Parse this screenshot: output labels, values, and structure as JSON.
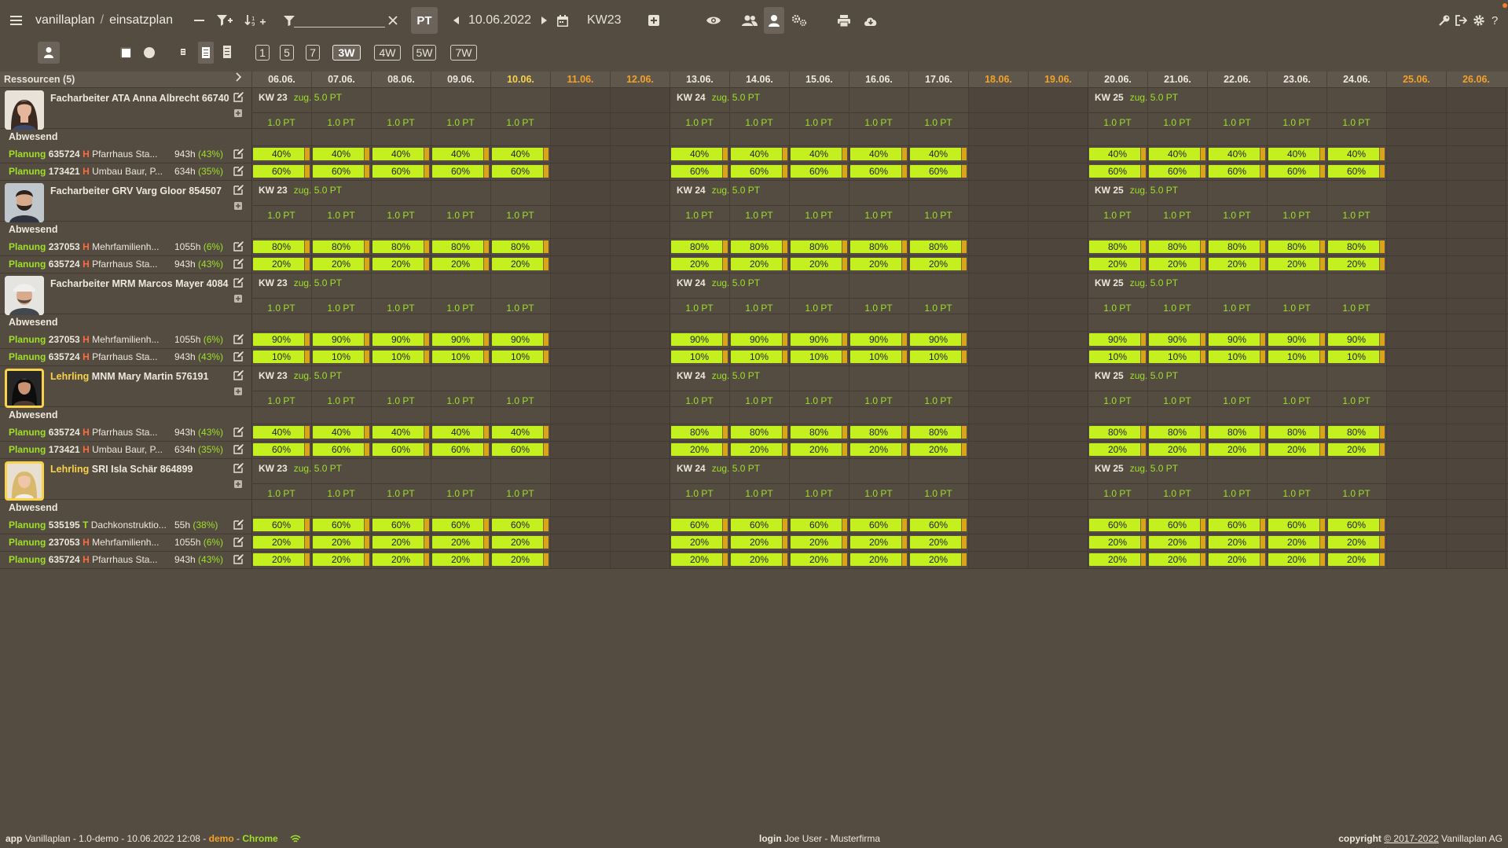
{
  "app": {
    "breadcrumb": [
      "vanillaplan",
      "einsatzplan"
    ],
    "pt_label": "PT",
    "date": "10.06.2022",
    "kw": "KW23",
    "filter_value": ""
  },
  "view_buttons": [
    "1",
    "5",
    "7",
    "3W",
    "4W",
    "5W",
    "7W"
  ],
  "selected_view": "3W",
  "resources_title": "Ressourcen (5)",
  "days": [
    {
      "label": "06.06.",
      "type": "normal"
    },
    {
      "label": "07.06.",
      "type": "normal"
    },
    {
      "label": "08.06.",
      "type": "normal"
    },
    {
      "label": "09.06.",
      "type": "normal"
    },
    {
      "label": "10.06.",
      "type": "current"
    },
    {
      "label": "11.06.",
      "type": "weekend"
    },
    {
      "label": "12.06.",
      "type": "weekend"
    },
    {
      "label": "13.06.",
      "type": "normal"
    },
    {
      "label": "14.06.",
      "type": "normal"
    },
    {
      "label": "15.06.",
      "type": "normal"
    },
    {
      "label": "16.06.",
      "type": "normal"
    },
    {
      "label": "17.06.",
      "type": "normal"
    },
    {
      "label": "18.06.",
      "type": "weekend"
    },
    {
      "label": "19.06.",
      "type": "weekend"
    },
    {
      "label": "20.06.",
      "type": "normal"
    },
    {
      "label": "21.06.",
      "type": "normal"
    },
    {
      "label": "22.06.",
      "type": "normal"
    },
    {
      "label": "23.06.",
      "type": "normal"
    },
    {
      "label": "24.06.",
      "type": "normal"
    },
    {
      "label": "25.06.",
      "type": "weekend"
    },
    {
      "label": "26.06.",
      "type": "weekend"
    }
  ],
  "weeks": [
    {
      "label": "KW 23",
      "zug": "zug. 5.0 PT"
    },
    {
      "label": "KW 24",
      "zug": "zug. 5.0 PT"
    },
    {
      "label": "KW 25",
      "zug": "zug. 5.0 PT"
    }
  ],
  "pt_cell_label": "1.0 PT",
  "absent_label": "Abwesend",
  "planung_label": "Planung",
  "resources": [
    {
      "role": "Facharbeiter",
      "name": "ATA Anna Albrecht 66740",
      "avatar": "woman-dark-hair",
      "yellow": false,
      "plans": [
        {
          "num": "635724",
          "kind": "H",
          "desc": "Pfarrhaus Sta...",
          "hours": "943h",
          "pct": "(43%)",
          "weeks": [
            "40%",
            "40%",
            "40%"
          ]
        },
        {
          "num": "173421",
          "kind": "H",
          "desc": "Umbau Baur, P...",
          "hours": "634h",
          "pct": "(35%)",
          "weeks": [
            "60%",
            "60%",
            "60%"
          ]
        }
      ]
    },
    {
      "role": "Facharbeiter",
      "name": "GRV Varg Gloor 854507",
      "avatar": "man-beard",
      "yellow": false,
      "plans": [
        {
          "num": "237053",
          "kind": "H",
          "desc": "Mehrfamilienh...",
          "hours": "1055h",
          "pct": "(6%)",
          "weeks": [
            "80%",
            "80%",
            "80%"
          ]
        },
        {
          "num": "635724",
          "kind": "H",
          "desc": "Pfarrhaus Sta...",
          "hours": "943h",
          "pct": "(43%)",
          "weeks": [
            "20%",
            "20%",
            "20%"
          ]
        }
      ]
    },
    {
      "role": "Facharbeiter",
      "name": "MRM Marcos Mayer 4084",
      "avatar": "man-cap",
      "yellow": false,
      "plans": [
        {
          "num": "237053",
          "kind": "H",
          "desc": "Mehrfamilienh...",
          "hours": "1055h",
          "pct": "(6%)",
          "weeks": [
            "90%",
            "90%",
            "90%"
          ]
        },
        {
          "num": "635724",
          "kind": "H",
          "desc": "Pfarrhaus Sta...",
          "hours": "943h",
          "pct": "(43%)",
          "weeks": [
            "10%",
            "10%",
            "10%"
          ]
        }
      ]
    },
    {
      "role": "Lehrling",
      "name": "MNM Mary Martin 576191",
      "avatar": "woman-black-hair",
      "yellow": true,
      "plans": [
        {
          "num": "635724",
          "kind": "H",
          "desc": "Pfarrhaus Sta...",
          "hours": "943h",
          "pct": "(43%)",
          "weeks": [
            "40%",
            "80%",
            "80%"
          ]
        },
        {
          "num": "173421",
          "kind": "H",
          "desc": "Umbau Baur, P...",
          "hours": "634h",
          "pct": "(35%)",
          "weeks": [
            "60%",
            "20%",
            "20%"
          ]
        }
      ]
    },
    {
      "role": "Lehrling",
      "name": "SRI Isla Schär 864899",
      "avatar": "woman-blonde",
      "yellow": true,
      "plans": [
        {
          "num": "535195",
          "kind": "T",
          "desc": "Dachkonstruktio...",
          "hours": "55h",
          "pct": "(38%)",
          "weeks": [
            "60%",
            "60%",
            "60%"
          ]
        },
        {
          "num": "237053",
          "kind": "H",
          "desc": "Mehrfamilienh...",
          "hours": "1055h",
          "pct": "(6%)",
          "weeks": [
            "20%",
            "20%",
            "20%"
          ]
        },
        {
          "num": "635724",
          "kind": "H",
          "desc": "Pfarrhaus Sta...",
          "hours": "943h",
          "pct": "(43%)",
          "weeks": [
            "20%",
            "20%",
            "20%"
          ]
        }
      ]
    }
  ],
  "footer": {
    "app_label": "app",
    "app_text": "Vanillaplan - 1.0-demo - 10.06.2022 12:08 -",
    "demo": "demo",
    "dash": "-",
    "browser": "Chrome",
    "login_label": "login",
    "login_text": "Joe User - Musterfirma",
    "copyright_label": "copyright",
    "copyright_years": "© 2017-2022",
    "copyright_owner": "Vanillaplan AG"
  }
}
